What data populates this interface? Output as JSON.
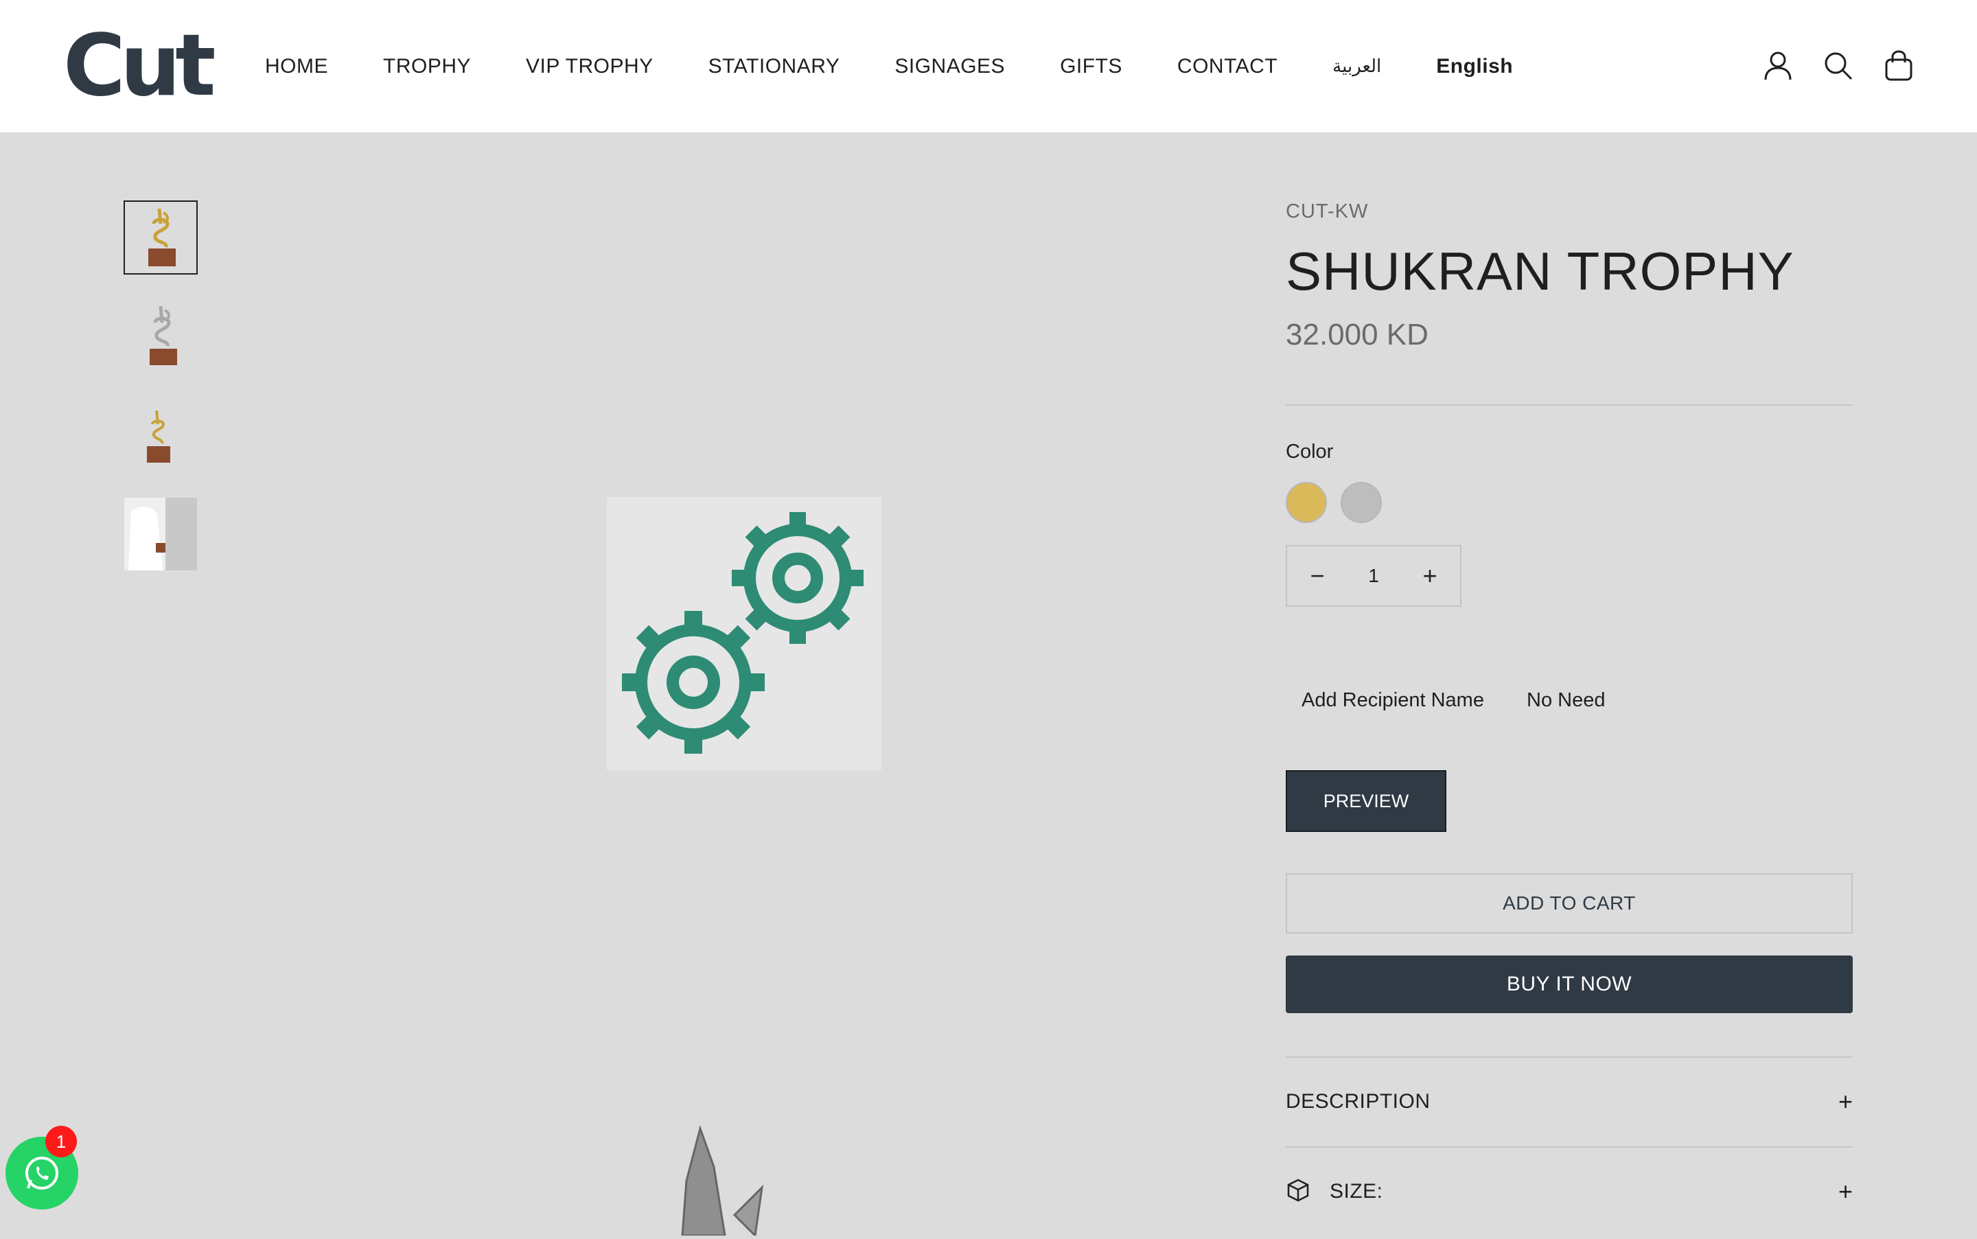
{
  "header": {
    "logo_text": "Cut",
    "nav": [
      "HOME",
      "TROPHY",
      "VIP TROPHY",
      "STATIONARY",
      "SIGNAGES",
      "GIFTS",
      "CONTACT"
    ],
    "lang_ar": "العربية",
    "lang_en": "English",
    "icons": [
      "account-icon",
      "search-icon",
      "cart-icon"
    ]
  },
  "gallery": {
    "thumbnail_count": 4,
    "active_index": 0,
    "main_image_icon": "gears-icon",
    "main_image_color": "#2e8b74"
  },
  "product": {
    "vendor": "CUT-KW",
    "title": "SHUKRAN TROPHY",
    "price": "32.000 KD",
    "color_label": "Color",
    "colors": [
      {
        "name": "gold",
        "hex": "#d9b95a"
      },
      {
        "name": "silver",
        "hex": "#bdbdbd"
      }
    ],
    "quantity": "1",
    "recipient_label": "Add Recipient Name",
    "recipient_value": "No Need",
    "preview_label": "PREVIEW",
    "add_to_cart_label": "ADD TO CART",
    "buy_now_label": "BUY IT NOW",
    "accordions": [
      {
        "label": "DESCRIPTION"
      },
      {
        "label": "SIZE:"
      }
    ]
  },
  "whatsapp": {
    "badge_count": "1",
    "color": "#25d366"
  }
}
